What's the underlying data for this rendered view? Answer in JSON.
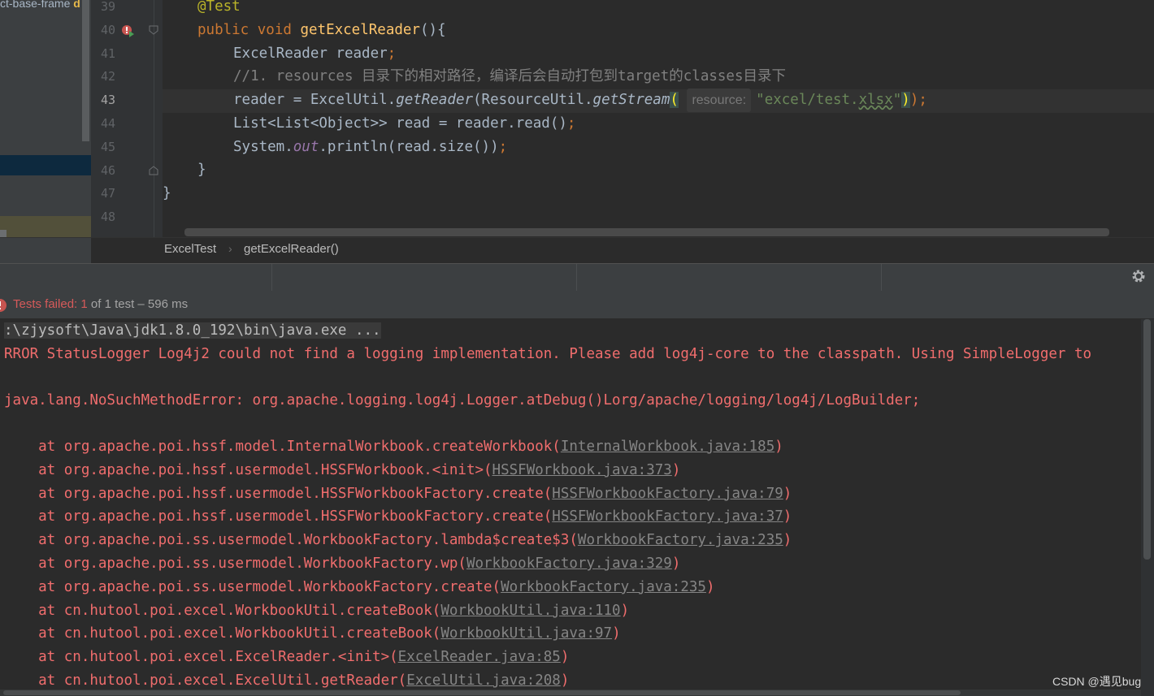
{
  "project_panel": {
    "label": "ct-base-frame",
    "marker": "d"
  },
  "editor": {
    "line_numbers": [
      "39",
      "40",
      "41",
      "42",
      "43",
      "44",
      "45",
      "46",
      "47",
      "48"
    ],
    "current_line": "43",
    "l39": {
      "annotation": "@Test"
    },
    "l40": {
      "kw1": "public",
      "kw2": "void",
      "method": "getExcelReader",
      "rest": "(){"
    },
    "l41": {
      "text": "ExcelReader reader",
      "semi": ";"
    },
    "l42": {
      "comment": "//1. resources 目录下的相对路径，编译后会自动打包到target的classes目录下"
    },
    "l43": {
      "p1": "reader = ExcelUtil.",
      "m1": "getReader",
      "p2": "(ResourceUtil.",
      "m2": "getStream",
      "open": "(",
      "hint": "resource:",
      "str_a": "\"excel/test.",
      "str_b": "xlsx",
      "str_c": "\"",
      "close": ")",
      "end": ");"
    },
    "l44": {
      "text": "List<List<Object>> read = reader.read()",
      "semi": ";"
    },
    "l45": {
      "p1": "System.",
      "field": "out",
      "p2": ".println(read.size())",
      "semi": ";"
    },
    "l46": {
      "text": "}"
    },
    "l47": {
      "text": "}"
    }
  },
  "breadcrumb": {
    "class_name": "ExcelTest",
    "separator": "›",
    "method_name": "getExcelReader()"
  },
  "run_panel": {
    "status": {
      "prefix": "Tests failed: ",
      "failed": "1",
      "suffix": " of 1 test – 596 ms"
    },
    "console": {
      "command": ":\\zjysoft\\Java\\jdk1.8.0_192\\bin\\java.exe ...",
      "error_logger": "RROR StatusLogger Log4j2 could not find a logging implementation. Please add log4j-core to the classpath. Using SimpleLogger to",
      "exception": "java.lang.NoSuchMethodError: org.apache.logging.log4j.Logger.atDebug()Lorg/apache/logging/log4j/LogBuilder;",
      "stack": [
        {
          "call": "    at org.apache.poi.hssf.model.InternalWorkbook.createWorkbook(",
          "link": "InternalWorkbook.java:185",
          "end": ")"
        },
        {
          "call": "    at org.apache.poi.hssf.usermodel.HSSFWorkbook.<init>(",
          "link": "HSSFWorkbook.java:373",
          "end": ")"
        },
        {
          "call": "    at org.apache.poi.hssf.usermodel.HSSFWorkbookFactory.create(",
          "link": "HSSFWorkbookFactory.java:79",
          "end": ")"
        },
        {
          "call": "    at org.apache.poi.hssf.usermodel.HSSFWorkbookFactory.create(",
          "link": "HSSFWorkbookFactory.java:37",
          "end": ")"
        },
        {
          "call": "    at org.apache.poi.ss.usermodel.WorkbookFactory.lambda$create$3(",
          "link": "WorkbookFactory.java:235",
          "end": ")"
        },
        {
          "call": "    at org.apache.poi.ss.usermodel.WorkbookFactory.wp(",
          "link": "WorkbookFactory.java:329",
          "end": ")"
        },
        {
          "call": "    at org.apache.poi.ss.usermodel.WorkbookFactory.create(",
          "link": "WorkbookFactory.java:235",
          "end": ")"
        },
        {
          "call": "    at cn.hutool.poi.excel.WorkbookUtil.createBook(",
          "link": "WorkbookUtil.java:110",
          "end": ")"
        },
        {
          "call": "    at cn.hutool.poi.excel.WorkbookUtil.createBook(",
          "link": "WorkbookUtil.java:97",
          "end": ")"
        },
        {
          "call": "    at cn.hutool.poi.excel.ExcelReader.<init>(",
          "link": "ExcelReader.java:85",
          "end": ")"
        },
        {
          "call": "    at cn.hutool.poi.excel.ExcelUtil.getReader(",
          "link": "ExcelUtil.java:208",
          "end": ")"
        }
      ]
    }
  },
  "watermark": "CSDN @遇见bug",
  "colors": {
    "error_red": "#f06d6d",
    "keyword": "#cc7832",
    "annotation": "#bbb529",
    "method": "#ffc66d",
    "string": "#6a8759",
    "background": "#2b2b2b"
  }
}
